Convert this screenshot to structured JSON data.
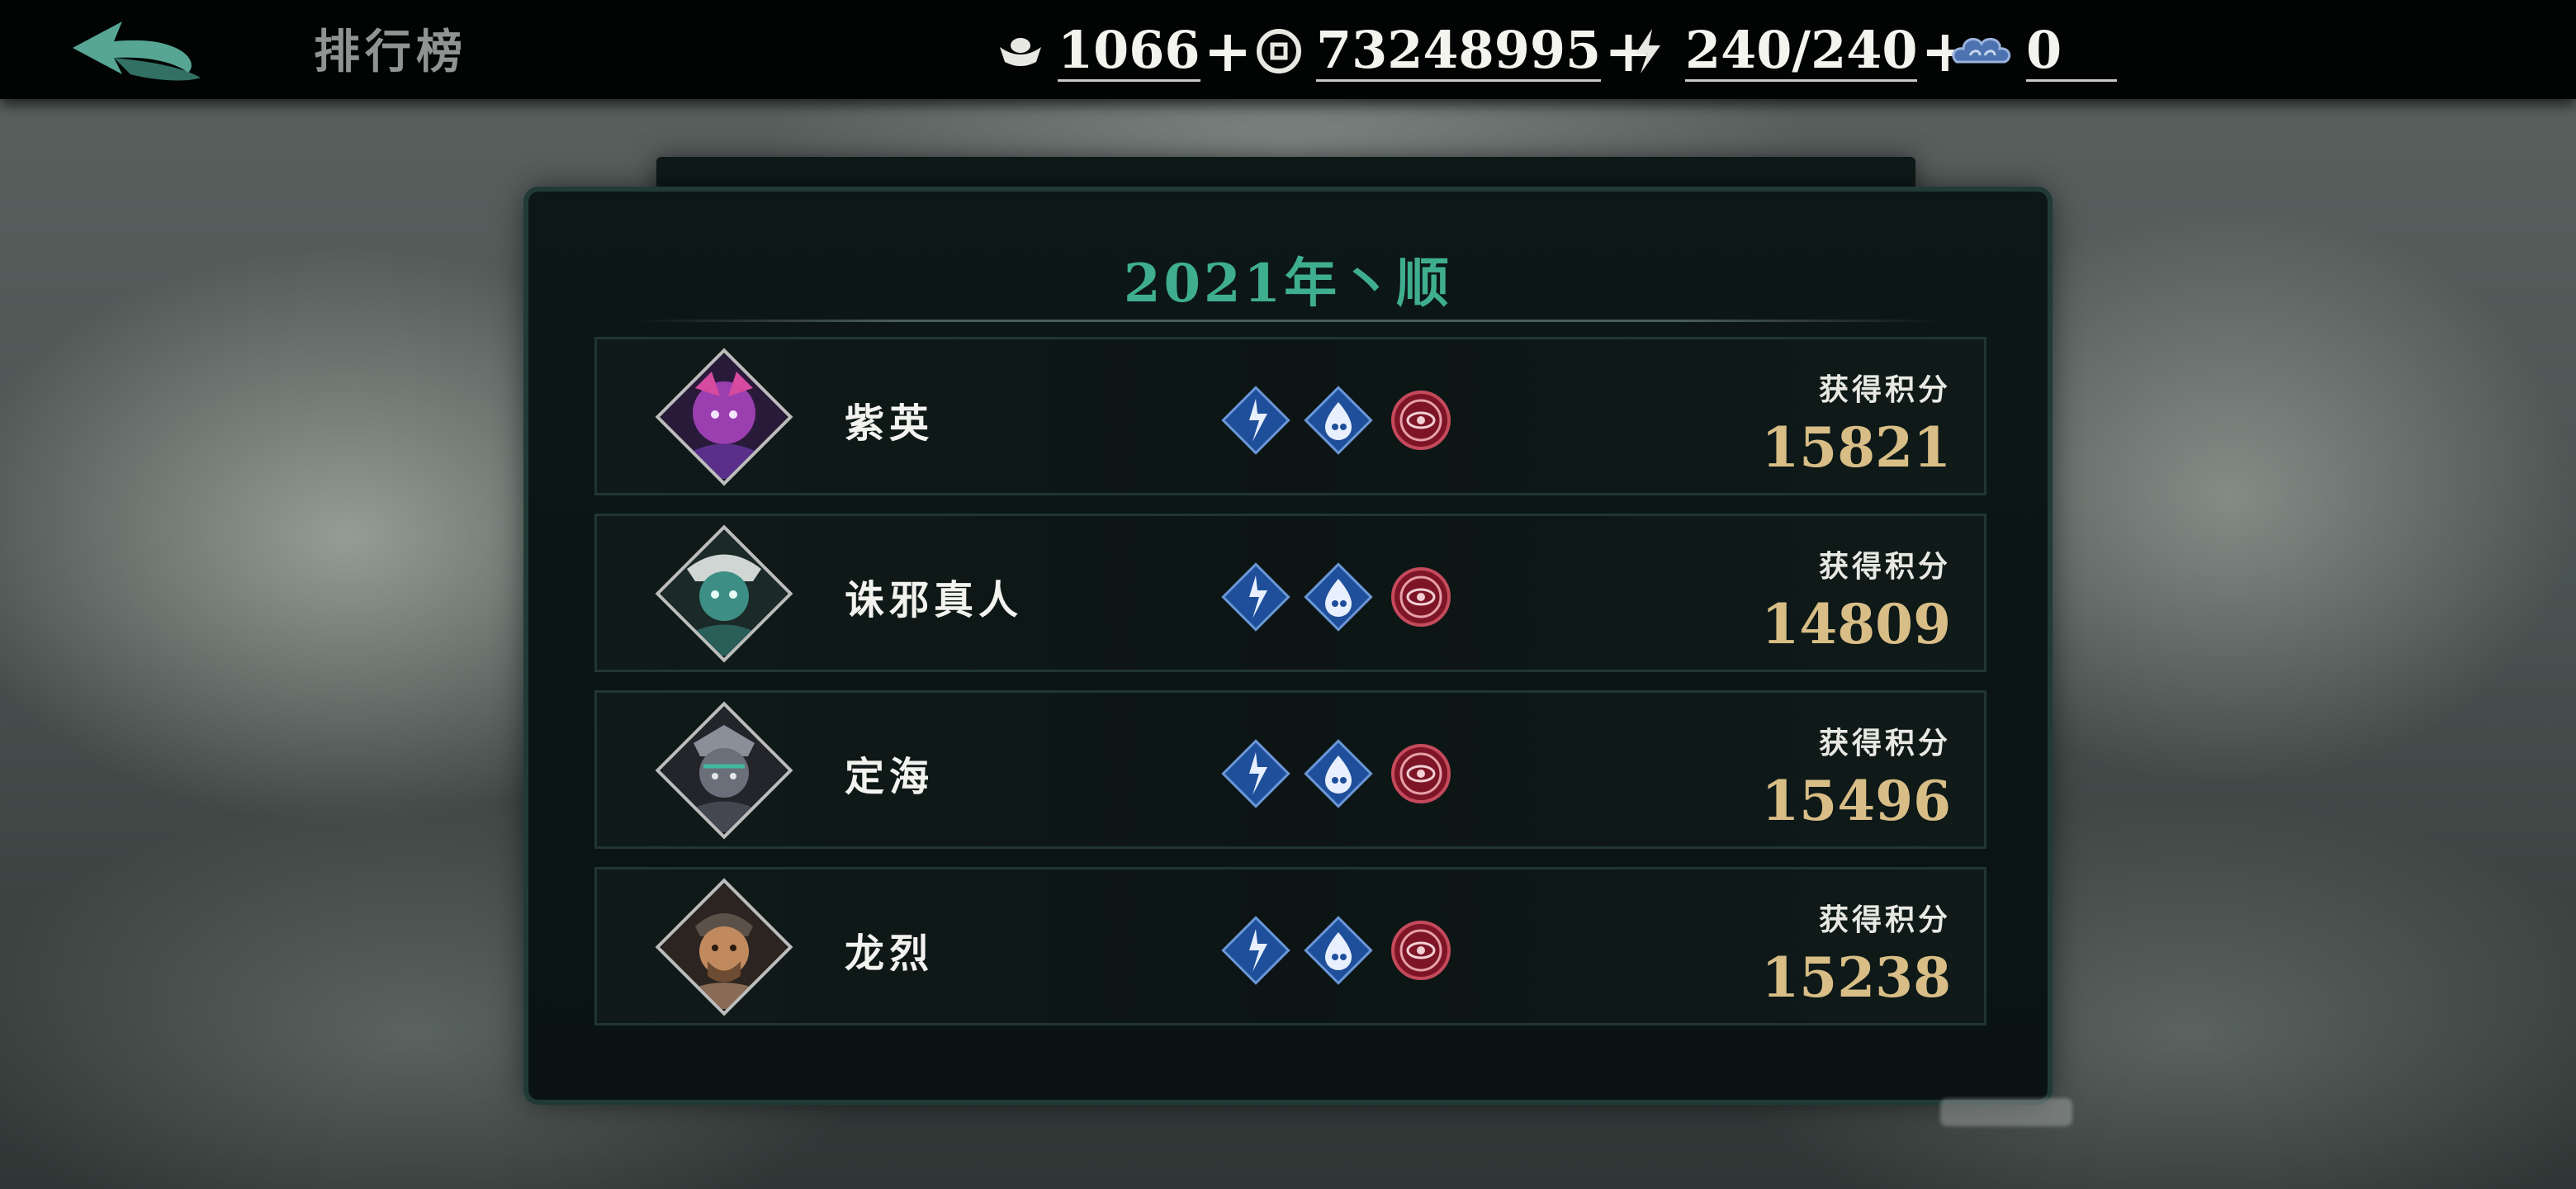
{
  "header": {
    "back_icon": "back-arrow-icon",
    "title": "排行榜",
    "resources": [
      {
        "icon": "ingot-icon",
        "value": "1066",
        "has_plus": true
      },
      {
        "icon": "coin-icon",
        "value": "73248995",
        "has_plus": true
      },
      {
        "icon": "lightning-icon",
        "value": "240/240",
        "has_plus": true
      },
      {
        "icon": "cloud-icon",
        "value": "0",
        "has_plus": false
      }
    ],
    "plus": "+"
  },
  "panel": {
    "title": "2021年丶顺",
    "rows": [
      {
        "name": "紫英",
        "score_label": "获得积分",
        "score": "15821",
        "avatar_color": "#9b3fb0"
      },
      {
        "name": "诛邪真人",
        "score_label": "获得积分",
        "score": "14809",
        "avatar_color": "#3d8f86"
      },
      {
        "name": "定海",
        "score_label": "获得积分",
        "score": "15496",
        "avatar_color": "#6b6f7a"
      },
      {
        "name": "龙烈",
        "score_label": "获得积分",
        "score": "15238",
        "avatar_color": "#8a6b55"
      }
    ],
    "skill_icons": [
      "lightning-burst-icon",
      "water-spirit-icon",
      "eye-seal-icon"
    ]
  },
  "colors": {
    "title_accent": "#3fae8f",
    "score_gold": "#d8be86",
    "skill_blue": "#2f66b8",
    "skill_red": "#9c1f2f"
  }
}
